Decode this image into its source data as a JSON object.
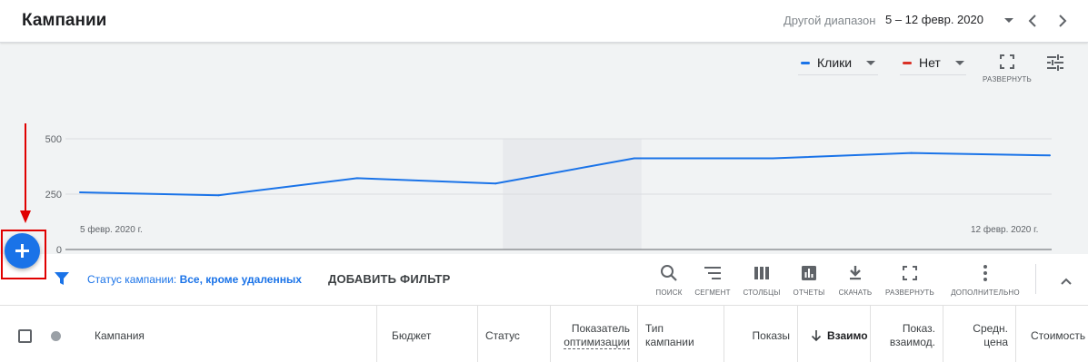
{
  "header": {
    "title": "Кампании",
    "range_label": "Другой диапазон",
    "range_value": "5 – 12 февр. 2020"
  },
  "chart_controls": {
    "metric1": {
      "label": "Клики",
      "color": "#1a73e8"
    },
    "metric2": {
      "label": "Нет",
      "color": "#d93025"
    },
    "expand_label": "РАЗВЕРНУТЬ"
  },
  "chart_data": {
    "type": "line",
    "x": [
      "2020-02-05",
      "2020-02-06",
      "2020-02-07",
      "2020-02-08",
      "2020-02-09",
      "2020-02-10",
      "2020-02-11",
      "2020-02-12"
    ],
    "series": [
      {
        "name": "Клики",
        "values": [
          258,
          245,
          322,
          298,
          412,
          412,
          436,
          425
        ]
      }
    ],
    "x_tick_labels": [
      "5 февр. 2020 г.",
      "12 февр. 2020 г."
    ],
    "y_ticks": [
      0,
      250,
      500
    ],
    "ylim": [
      0,
      500
    ],
    "highlight_range": [
      "2020-02-08",
      "2020-02-09"
    ],
    "grid": true,
    "line_color": "#1a73e8"
  },
  "filter_bar": {
    "status_prefix": "Статус кампании:",
    "status_value": "Все, кроме удаленных",
    "add_filter": "ДОБАВИТЬ ФИЛЬТР",
    "tools": [
      {
        "name": "search",
        "icon": "search-icon",
        "label": "ПОИСК"
      },
      {
        "name": "segment",
        "icon": "segment-icon",
        "label": "СЕГМЕНТ"
      },
      {
        "name": "columns",
        "icon": "columns-icon",
        "label": "СТОЛБЦЫ"
      },
      {
        "name": "reports",
        "icon": "reports-icon",
        "label": "ОТЧЕТЫ"
      },
      {
        "name": "download",
        "icon": "download-icon",
        "label": "СКАЧАТЬ"
      },
      {
        "name": "expand",
        "icon": "fullscreen-icon",
        "label": "РАЗВЕРНУТЬ"
      },
      {
        "name": "more",
        "icon": "more-vert-icon",
        "label": "ДОПОЛНИТЕЛЬНО"
      }
    ]
  },
  "table": {
    "columns": {
      "campaign": "Кампания",
      "budget": "Бюджет",
      "status": "Статус",
      "opt_line1": "Показатель",
      "opt_line2": "оптимизации",
      "type_line1": "Тип",
      "type_line2": "кампании",
      "impressions": "Показы",
      "interactions": "Взаимо",
      "intrate_line1": "Показ.",
      "intrate_line2": "взаимод.",
      "avgcost_line1": "Средн.",
      "avgcost_line2": "цена",
      "cost": "Стоимость"
    }
  }
}
